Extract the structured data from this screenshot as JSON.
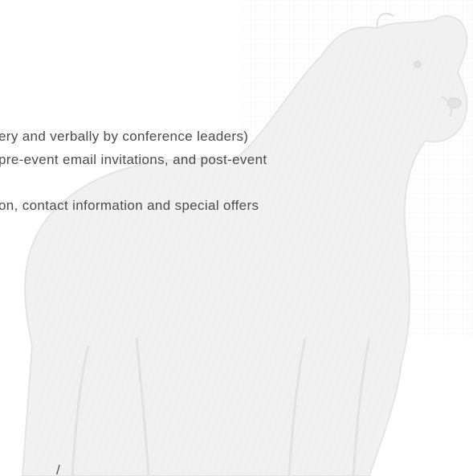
{
  "document": {
    "lines": [
      "ery and verbally by conference leaders)",
      "pre-event email invitations, and post-event",
      "on, contact information and special offers"
    ],
    "bottom_fragment": "/"
  },
  "watermark": {
    "icon": "polar-bear-sketch-icon",
    "color": "#ebebeb",
    "grid_color": "#e6e6e6"
  }
}
